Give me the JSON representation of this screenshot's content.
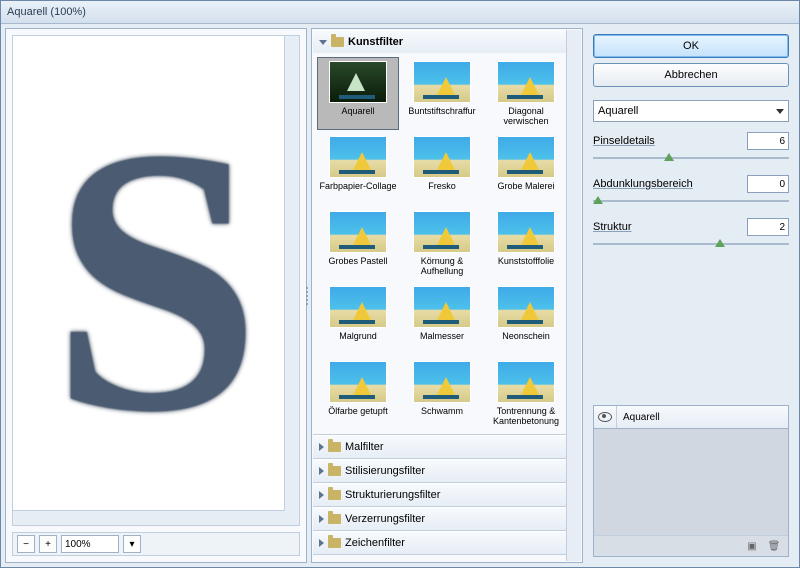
{
  "title": "Aquarell (100%)",
  "zoom": {
    "value": "100%",
    "minus": "−",
    "plus": "+"
  },
  "gallery": {
    "open_category": "Kunstfilter",
    "thumbs": [
      {
        "label": "Aquarell",
        "selected": true
      },
      {
        "label": "Buntstiftschraffur"
      },
      {
        "label": "Diagonal verwischen"
      },
      {
        "label": "Farbpapier-Collage"
      },
      {
        "label": "Fresko"
      },
      {
        "label": "Grobe Malerei"
      },
      {
        "label": "Grobes Pastell"
      },
      {
        "label": "Körnung & Aufhellung"
      },
      {
        "label": "Kunststofffolie"
      },
      {
        "label": "Malgrund"
      },
      {
        "label": "Malmesser"
      },
      {
        "label": "Neonschein"
      },
      {
        "label": "Ölfarbe getupft"
      },
      {
        "label": "Schwamm"
      },
      {
        "label": "Tontrennung & Kantenbetonung"
      }
    ],
    "closed_categories": [
      "Malfilter",
      "Stilisierungsfilter",
      "Strukturierungsfilter",
      "Verzerrungsfilter",
      "Zeichenfilter"
    ]
  },
  "controls": {
    "ok": "OK",
    "cancel": "Abbrechen",
    "filter_select": "Aquarell",
    "params": [
      {
        "label": "Pinseldetails",
        "value": "6",
        "pos": 36
      },
      {
        "label": "Abdunklungsbereich",
        "value": "0",
        "pos": 0
      },
      {
        "label": "Struktur",
        "value": "2",
        "pos": 62
      }
    ]
  },
  "layers": {
    "title": "Aquarell"
  }
}
